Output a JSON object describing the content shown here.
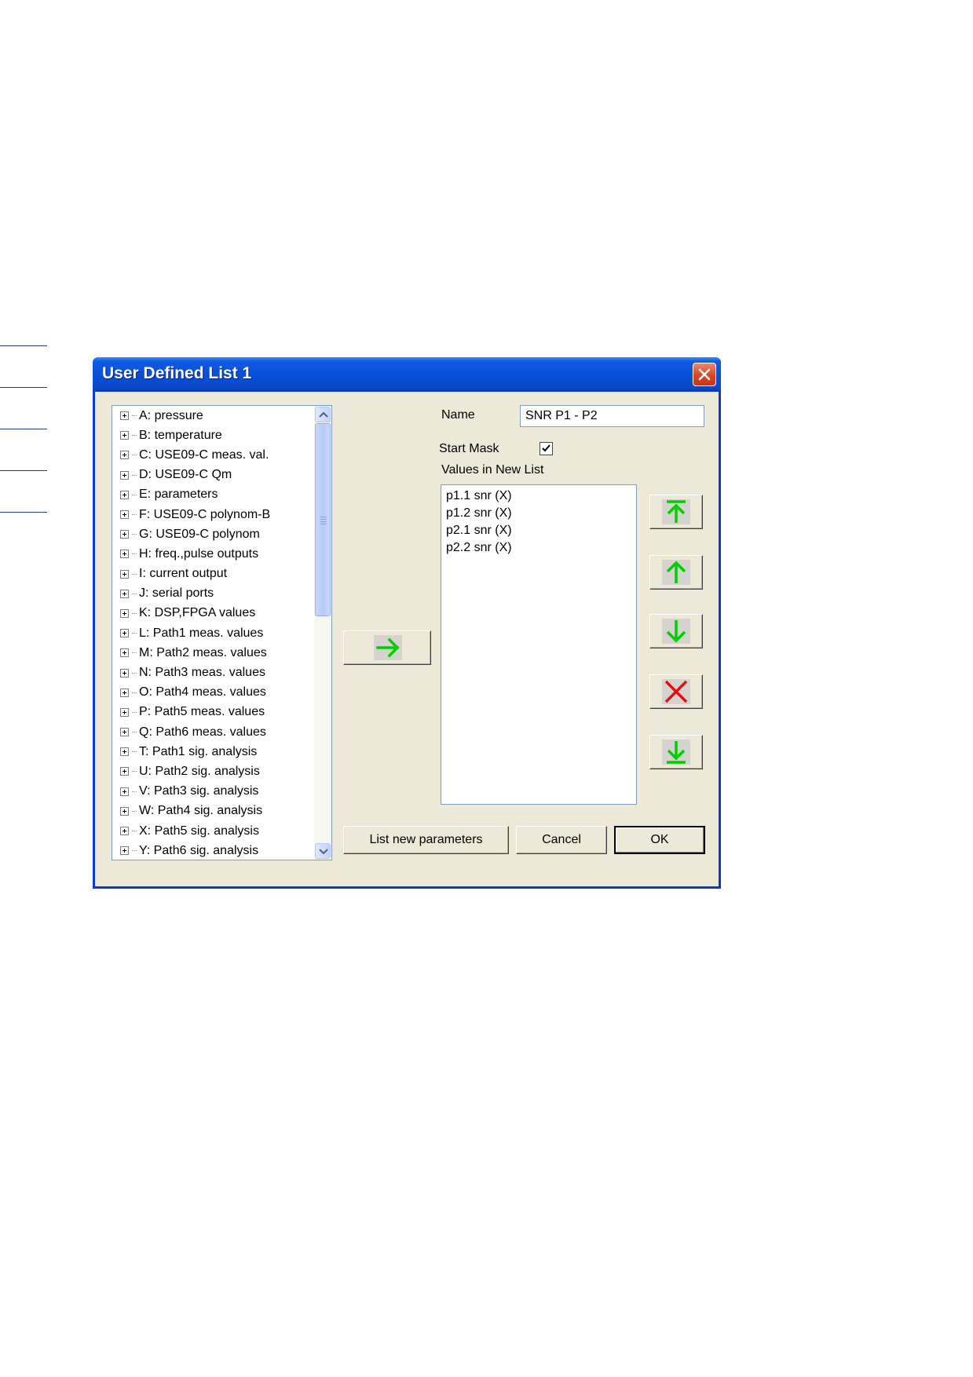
{
  "window": {
    "title": "User Defined List 1"
  },
  "tree": {
    "items": [
      {
        "label": "A: pressure"
      },
      {
        "label": "B: temperature"
      },
      {
        "label": "C: USE09-C meas. val."
      },
      {
        "label": "D: USE09-C Qm"
      },
      {
        "label": "E: parameters"
      },
      {
        "label": "F: USE09-C polynom-B"
      },
      {
        "label": "G: USE09-C polynom"
      },
      {
        "label": "H: freq.,pulse outputs"
      },
      {
        "label": "I: current output"
      },
      {
        "label": "J: serial ports"
      },
      {
        "label": "K: DSP,FPGA values"
      },
      {
        "label": "L: Path1 meas. values"
      },
      {
        "label": "M: Path2 meas. values"
      },
      {
        "label": "N: Path3 meas. values"
      },
      {
        "label": "O: Path4 meas. values"
      },
      {
        "label": "P: Path5 meas. values"
      },
      {
        "label": "Q: Path6 meas. values"
      },
      {
        "label": "T: Path1 sig. analysis"
      },
      {
        "label": "U: Path2 sig. analysis"
      },
      {
        "label": "V: Path3 sig. analysis"
      },
      {
        "label": "W: Path4 sig. analysis"
      },
      {
        "label": "X: Path5 sig. analysis"
      },
      {
        "label": "Y: Path6 sig. analysis"
      }
    ]
  },
  "form": {
    "name_label": "Name",
    "name_value": "SNR P1 - P2",
    "start_mask_label": "Start Mask",
    "start_mask_checked": true,
    "values_label": "Values in New List",
    "values": [
      "p1.1 snr (X)",
      "p1.2 snr (X)",
      "p2.1 snr (X)",
      "p2.2 snr (X)"
    ]
  },
  "buttons": {
    "list_new_parameters": "List new parameters",
    "cancel": "Cancel",
    "ok": "OK"
  },
  "icons": {
    "add": "arrow-right-icon",
    "move_top": "arrow-to-top-icon",
    "move_up": "arrow-up-icon",
    "move_down": "arrow-down-icon",
    "delete": "red-x-icon",
    "move_bottom": "arrow-to-bottom-icon"
  },
  "colors": {
    "arrow": "#00d000",
    "delete": "#e01010",
    "titlebar": "#0a47c8"
  }
}
